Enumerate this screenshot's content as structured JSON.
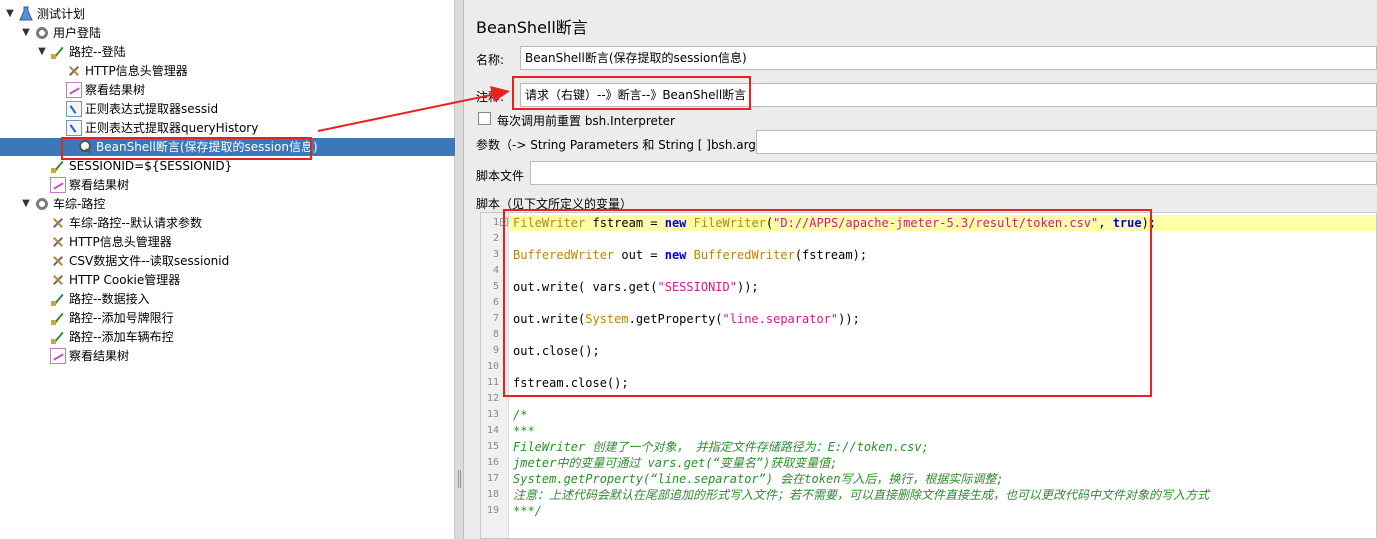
{
  "tree": {
    "items": [
      {
        "label": "测试计划",
        "icon": "flask-icon",
        "toggle": "▼"
      },
      {
        "label": "用户登陆",
        "icon": "gear-icon",
        "toggle": "▼"
      },
      {
        "label": "路控--登陆",
        "icon": "broom-icon",
        "toggle": "▼"
      },
      {
        "label": "HTTP信息头管理器",
        "icon": "wrench-icon",
        "toggle": ""
      },
      {
        "label": "察看结果树",
        "icon": "graph-icon",
        "toggle": ""
      },
      {
        "label": "正则表达式提取器sessid",
        "icon": "extractor-icon",
        "toggle": ""
      },
      {
        "label": "正则表达式提取器queryHistory",
        "icon": "extractor-icon",
        "toggle": ""
      },
      {
        "label": "BeanShell断言(保存提取的session信息)",
        "icon": "magnifier-icon",
        "toggle": ""
      },
      {
        "label": "SESSIONID=${SESSIONID}",
        "icon": "broom-icon",
        "toggle": ""
      },
      {
        "label": "察看结果树",
        "icon": "graph-icon",
        "toggle": ""
      },
      {
        "label": "车综-路控",
        "icon": "gear-icon",
        "toggle": "▼"
      },
      {
        "label": "车综-路控--默认请求参数",
        "icon": "wrench-icon",
        "toggle": ""
      },
      {
        "label": "HTTP信息头管理器",
        "icon": "wrench-icon",
        "toggle": ""
      },
      {
        "label": "CSV数据文件--读取sessionid",
        "icon": "wrench-icon",
        "toggle": ""
      },
      {
        "label": "HTTP Cookie管理器",
        "icon": "wrench-icon",
        "toggle": ""
      },
      {
        "label": "路控--数据接入",
        "icon": "broom-icon",
        "toggle": ""
      },
      {
        "label": "路控--添加号牌限行",
        "icon": "broom-icon",
        "toggle": ""
      },
      {
        "label": "路控--添加车辆布控",
        "icon": "broom-icon",
        "toggle": ""
      },
      {
        "label": "察看结果树",
        "icon": "graph-icon",
        "toggle": ""
      }
    ]
  },
  "panel": {
    "title": "BeanShell断言",
    "name_label": "名称:",
    "name_value": "BeanShell断言(保存提取的session信息)",
    "comment_label": "注释:",
    "comment_value": "请求（右键）--》断言--》BeanShell断言",
    "reset_label": "每次调用前重置 bsh.Interpreter",
    "params_label": "参数（-> String Parameters 和 String [ ]bsh.args）",
    "params_value": "",
    "file_label": "脚本文件",
    "file_value": "",
    "script_label": "脚本（见下文所定义的变量）"
  },
  "script": {
    "line_numbers": [
      "1",
      "2",
      "3",
      "4",
      "5",
      "6",
      "7",
      "8",
      "9",
      "10",
      "11",
      "12",
      "13",
      "14",
      "15",
      "16",
      "17",
      "18",
      "19"
    ],
    "l1": {
      "t1": "FileWriter",
      "sp1": " fstream = ",
      "kw1": "new",
      "sp2": " ",
      "t2": "FileWriter",
      "p1": "(",
      "s1": "\"D://APPS/apache-jmeter-5.3/result/token.csv\"",
      "p2": ", ",
      "kw2": "true",
      "p3": ");"
    },
    "l3": {
      "t1": "BufferedWriter",
      "sp1": " out = ",
      "kw1": "new",
      "sp2": " ",
      "t2": "BufferedWriter",
      "rest": "(fstream);"
    },
    "l5": {
      "a": "out.write(",
      "b": " vars.get(",
      "s": "\"SESSIONID\"",
      "c": "));"
    },
    "l7": {
      "a": "out.write(",
      "t": "System",
      "b": ".getProperty(",
      "s": "\"line.separator\"",
      "c": "));"
    },
    "l9": "out.close();",
    "l11": "fstream.close();",
    "comments": [
      "/*",
      "***",
      "FileWriter 创建了一个对象， 并指定文件存储路径为：E://token.csv;",
      "jmeter中的变量可通过 vars.get(“变量名”)获取变量值;",
      "System.getProperty(“line.separator”) 会在token写入后，换行，根据实际调整;",
      "注意：上述代码会默认在尾部追加的形式写入文件；若不需要，可以直接删除文件直接生成，也可以更改代码中文件对象的写入方式",
      "***/"
    ]
  }
}
